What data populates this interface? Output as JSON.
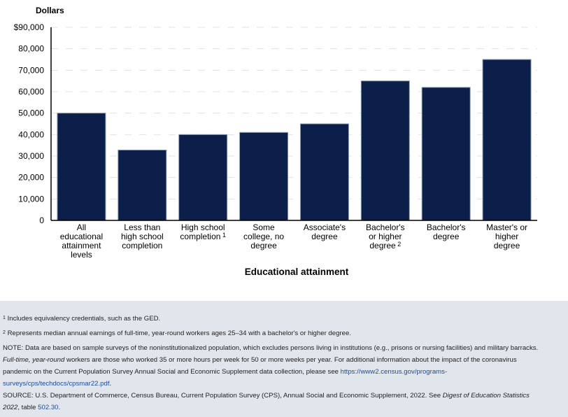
{
  "chart_data": {
    "type": "bar",
    "title": "",
    "ylabel": "Dollars",
    "xlabel": "Educational attainment",
    "ylim": [
      0,
      90000
    ],
    "yticks": [
      0,
      10000,
      20000,
      30000,
      40000,
      50000,
      60000,
      70000,
      80000,
      90000
    ],
    "ytick_labels": [
      "0",
      "10,000",
      "20,000",
      "30,000",
      "40,000",
      "50,000",
      "60,000",
      "70,000",
      "80,000",
      "$90,000"
    ],
    "grid": "horizontal dashed",
    "bar_color": "#0b1f4a",
    "categories": [
      {
        "lines": [
          "All",
          "educational",
          "attainment",
          "levels"
        ],
        "footnote": ""
      },
      {
        "lines": [
          "Less than",
          "high school",
          "completion"
        ],
        "footnote": ""
      },
      {
        "lines": [
          "High school",
          "completion"
        ],
        "footnote": "1"
      },
      {
        "lines": [
          "Some",
          "college, no",
          "degree"
        ],
        "footnote": ""
      },
      {
        "lines": [
          "Associate's",
          "degree"
        ],
        "footnote": ""
      },
      {
        "lines": [
          "Bachelor's",
          "or higher",
          "degree"
        ],
        "footnote": "2"
      },
      {
        "lines": [
          "Bachelor's",
          "degree"
        ],
        "footnote": ""
      },
      {
        "lines": [
          "Master's or",
          "higher",
          "degree"
        ],
        "footnote": ""
      }
    ],
    "values": [
      50000,
      32800,
      40000,
      41000,
      45000,
      65000,
      62000,
      75000
    ]
  },
  "notes": {
    "fn1_mark": "1",
    "fn1_text": "Includes equivalency credentials, such as the GED.",
    "fn2_mark": "2",
    "fn2_text": "Represents median annual earnings of full-time, year-round workers ages 25–34 with a bachelor's or higher degree.",
    "note_line1": "NOTE: Data are based on sample surveys of the noninstitutionalized population, which excludes persons living in institutions (e.g., prisons or nursing facilities) and military barracks.",
    "note_italic": "Full-time, year-round",
    "note_line2": " workers are those who worked 35 or more hours per week for 50 or more weeks per year. For additional information about the impact of the coronavirus",
    "note_line3": "pandemic on the Current Population Survey Annual Social and Economic Supplement data collection, please see ",
    "note_link_part1": "https://www2.census.gov/programs-",
    "note_link_part2": "surveys/cps/techdocs/cpsmar22.pdf",
    "note_end": ".",
    "source_line1": "SOURCE: U.S. Department of Commerce, Census Bureau, Current Population Survey (CPS), Annual Social and Economic Supplement, 2022. See ",
    "source_italic1": "Digest of Education Statistics",
    "source_italic2": "2022",
    "source_mid": ", table ",
    "source_link": "502.30",
    "source_end": "."
  }
}
